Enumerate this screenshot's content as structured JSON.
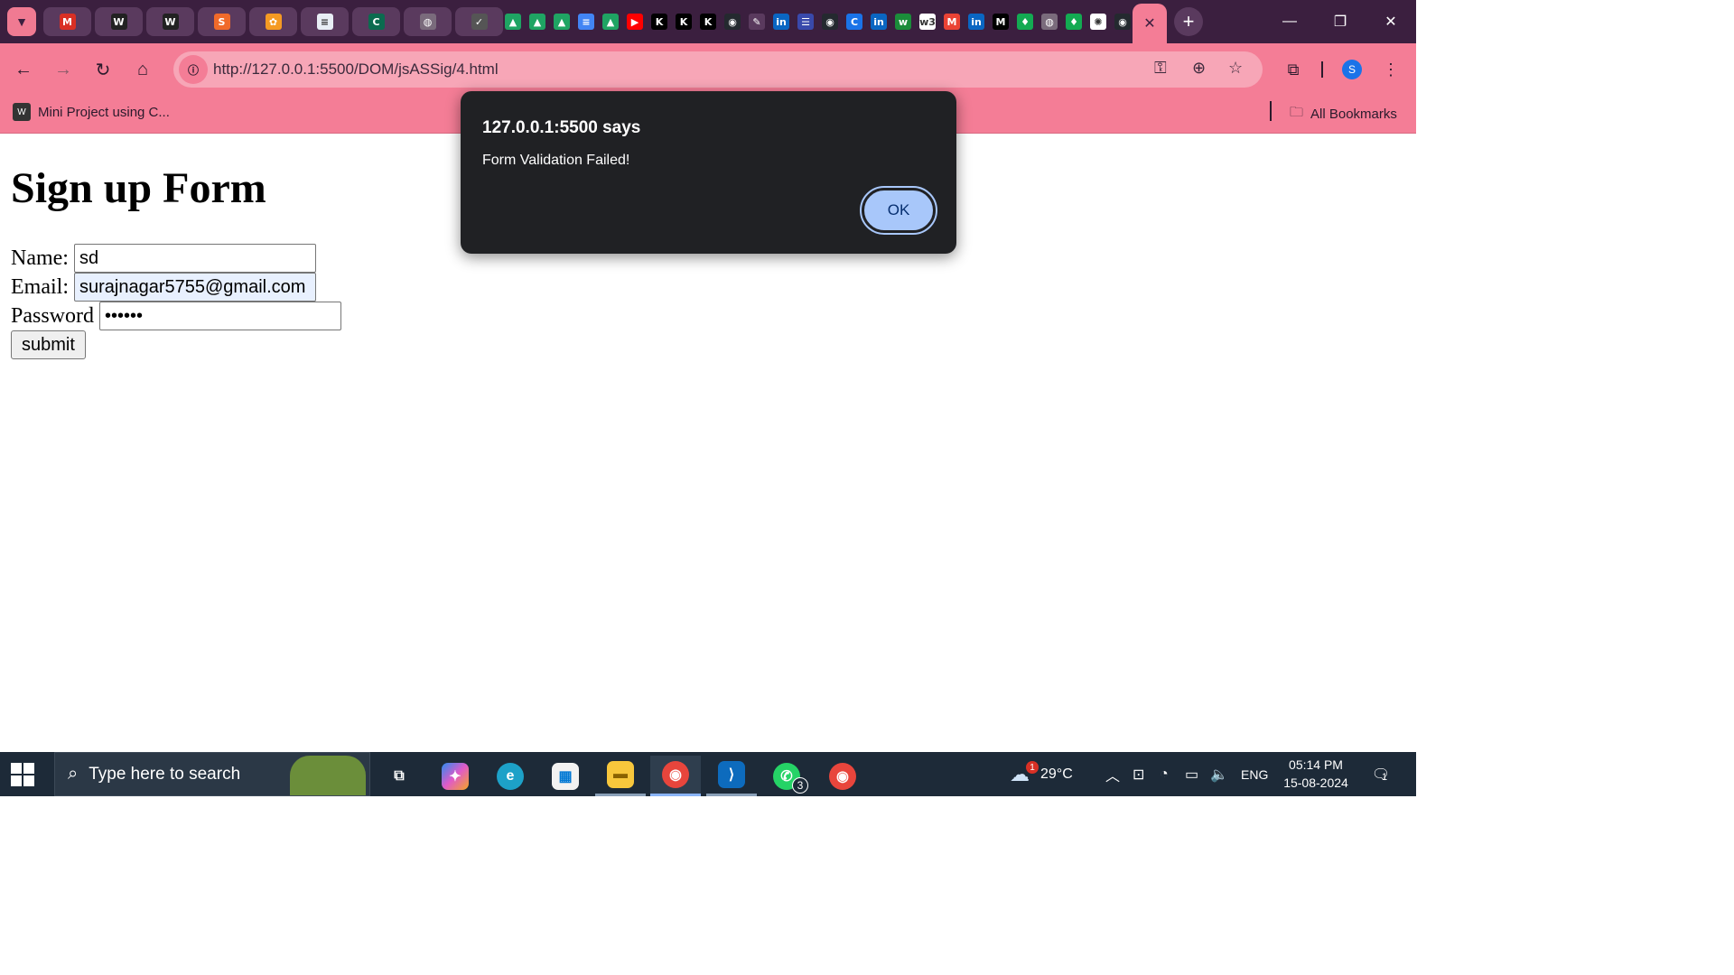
{
  "browser": {
    "url": "http://127.0.0.1:5500/DOM/jsASSig/4.html",
    "active_tab_close": "✕",
    "new_tab": "+",
    "profile_initial": "S",
    "pinned_tabs": [
      {
        "icon": "gmail-icon",
        "glyph": "M",
        "color": "#d93025"
      },
      {
        "icon": "wordpress-icon",
        "glyph": "W",
        "color": "#222222"
      },
      {
        "icon": "wordpress-icon",
        "glyph": "W",
        "color": "#222222"
      },
      {
        "icon": "stackblitz-icon",
        "glyph": "S",
        "color": "#f06a2a"
      },
      {
        "icon": "orange-app-icon",
        "glyph": "✿",
        "color": "#f59a23"
      },
      {
        "icon": "document-icon",
        "glyph": "≡",
        "color": "#e8eef5"
      },
      {
        "icon": "c-app-icon",
        "glyph": "C",
        "color": "#0b6b4f"
      },
      {
        "icon": "globe-icon",
        "glyph": "◍",
        "color": "#7a6b7c"
      },
      {
        "icon": "check-shield-icon",
        "glyph": "✓",
        "color": "#555555"
      }
    ],
    "small_tabs": [
      {
        "icon": "google-drive-icon",
        "glyph": "▲",
        "color": "#1fa463"
      },
      {
        "icon": "google-drive-icon",
        "glyph": "▲",
        "color": "#1fa463"
      },
      {
        "icon": "google-drive-icon",
        "glyph": "▲",
        "color": "#1fa463"
      },
      {
        "icon": "google-docs-icon",
        "glyph": "≡",
        "color": "#4285f4"
      },
      {
        "icon": "google-drive-icon",
        "glyph": "▲",
        "color": "#1fa463"
      },
      {
        "icon": "youtube-icon",
        "glyph": "▶",
        "color": "#ff0000"
      },
      {
        "icon": "k-app-icon",
        "glyph": "K",
        "color": "#000000"
      },
      {
        "icon": "k-app-icon",
        "glyph": "K",
        "color": "#000000"
      },
      {
        "icon": "k-app-icon",
        "glyph": "K",
        "color": "#000000"
      },
      {
        "icon": "github-icon",
        "glyph": "◉",
        "color": "#24292f"
      },
      {
        "icon": "pencil-icon",
        "glyph": "✎",
        "color": "#5a3a5e"
      },
      {
        "icon": "linkedin-icon",
        "glyph": "in",
        "color": "#0a66c2"
      },
      {
        "icon": "form-icon",
        "glyph": "☰",
        "color": "#3949ab"
      },
      {
        "icon": "github-icon",
        "glyph": "◉",
        "color": "#24292f"
      },
      {
        "icon": "c-app-icon",
        "glyph": "C",
        "color": "#1a73e8"
      },
      {
        "icon": "linkedin-icon",
        "glyph": "in",
        "color": "#0a66c2"
      },
      {
        "icon": "w-app-icon",
        "glyph": "w",
        "color": "#1b8c3a"
      },
      {
        "icon": "w3schools-icon",
        "glyph": "w3",
        "color": "#ffffff"
      },
      {
        "icon": "gmail-icon",
        "glyph": "M",
        "color": "#ea4335"
      },
      {
        "icon": "linkedin-icon",
        "glyph": "in",
        "color": "#0a66c2"
      },
      {
        "icon": "medium-icon",
        "glyph": "M",
        "color": "#000000"
      },
      {
        "icon": "mongodb-icon",
        "glyph": "♦",
        "color": "#13aa52"
      },
      {
        "icon": "globe-icon",
        "glyph": "◍",
        "color": "#7a6b7c"
      },
      {
        "icon": "mongodb-icon",
        "glyph": "♦",
        "color": "#13aa52"
      },
      {
        "icon": "chatgpt-icon",
        "glyph": "✺",
        "color": "#ffffff"
      },
      {
        "icon": "github-icon",
        "glyph": "◉",
        "color": "#24292f"
      }
    ]
  },
  "bookmarks": {
    "first": "Mini Project using C...",
    "all": "All Bookmarks"
  },
  "page": {
    "title": "Sign up Form",
    "name_label": "Name:",
    "name_value": "sd",
    "email_label": "Email:",
    "email_value": "surajnagar5755@gmail.com",
    "password_label": "Password",
    "password_value": "••••••",
    "submit_label": "submit"
  },
  "dialog": {
    "title": "127.0.0.1:5500 says",
    "message": "Form Validation Failed!",
    "ok_label": "OK"
  },
  "taskbar": {
    "search_placeholder": "Type here to search",
    "weather_temp": "29°C",
    "weather_badge": "1",
    "language": "ENG",
    "time": "05:14 PM",
    "date": "15-08-2024",
    "notification_count": "1",
    "whatsapp_badge": "3",
    "accent": "#8ab4f8"
  }
}
